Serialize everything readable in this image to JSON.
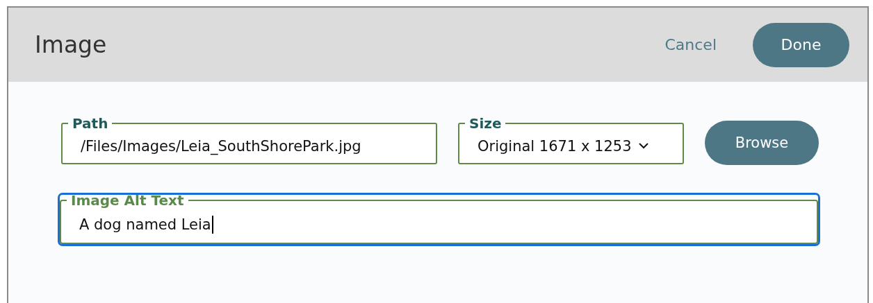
{
  "window": {
    "title": "Image"
  },
  "header_buttons": [
    {
      "label": "Cancel",
      "kind": "link"
    },
    {
      "label": "Done",
      "kind": "primary"
    }
  ],
  "fields": [
    {
      "label": "Path",
      "kind": "text",
      "value": "/Files/Images/Leia_SouthShorePark.jpg",
      "focused": false
    },
    {
      "label": "Size",
      "kind": "select",
      "value": "Original 1671 x 1253"
    },
    {
      "label": "Browse",
      "kind": "button"
    },
    {
      "label": "Image Alt Text",
      "kind": "text",
      "value": "A dog named Leia",
      "focused": true
    }
  ]
}
